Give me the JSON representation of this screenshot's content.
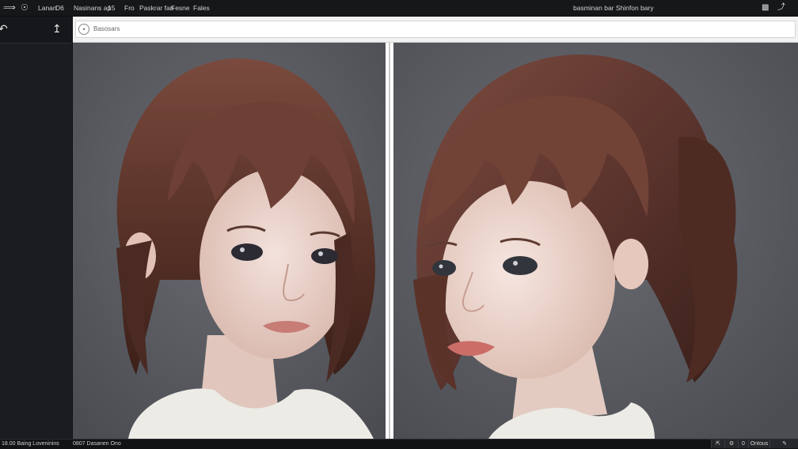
{
  "menubar": {
    "back_icon": "forward-arrow-icon",
    "app_icon": "circle-dot-icon",
    "items": [
      "Lanan",
      "D6",
      "Nasinans ap",
      "15",
      "Fro",
      "Paskrar fan",
      "Fesne",
      "Fales"
    ],
    "right_title": "basminan bar Shinfon bary",
    "right_icons": [
      "document-icon",
      "pin-icon"
    ]
  },
  "sidebar": {
    "icons": [
      "undo-arrow-icon",
      "upload-arrow-icon"
    ]
  },
  "addressbar": {
    "icon": "spiral-icon",
    "text": "Basosars"
  },
  "panels": {
    "left_image": "portrait-front-view",
    "right_image": "portrait-side-view"
  },
  "statusbar": {
    "left_text": "18.00 Baing Loveninins",
    "mid_text": "0807 Dasanen Ono",
    "buttons": [
      "resize-icon",
      "settings-icon",
      "0",
      "Ontous",
      "pencil-icon"
    ]
  },
  "colors": {
    "menubar_bg": "#161719",
    "sidebar_bg": "#1b1c1f",
    "panel_bg": "#5b5d63",
    "hair": "#6b3f34"
  }
}
